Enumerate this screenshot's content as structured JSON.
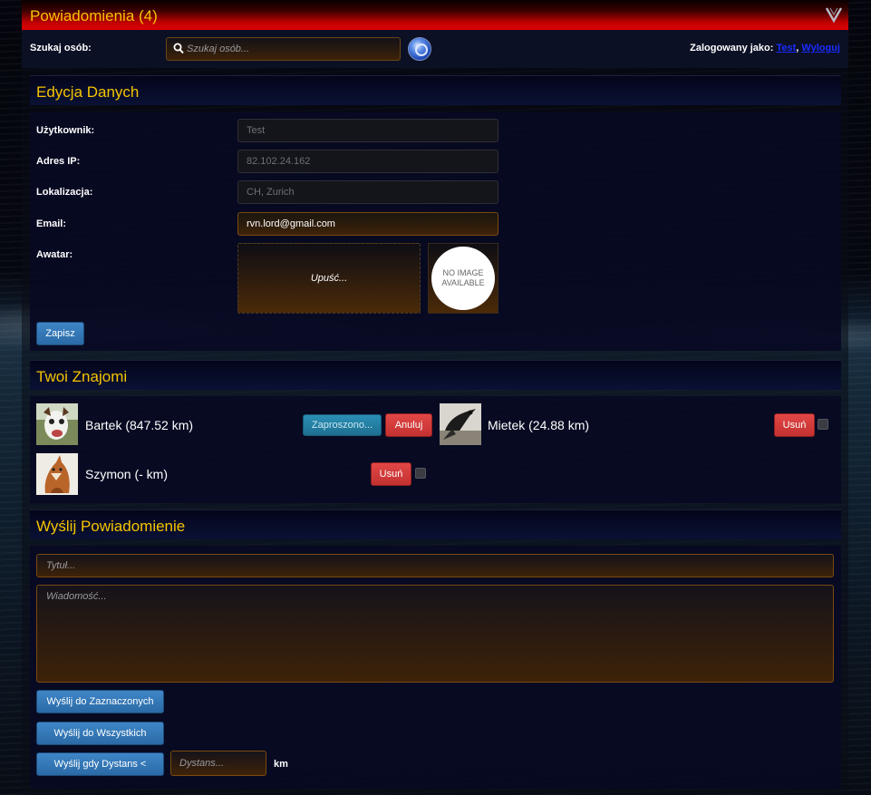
{
  "notifications": {
    "title": "Powiadomienia (4)",
    "toggle_icon": "chevron-down-icon"
  },
  "topbar": {
    "search_label": "Szukaj osób:",
    "search_placeholder": "Szukaj osób...",
    "logged_as_label": "Zalogowany jako:",
    "username_link": "Test",
    "separator": ",",
    "logout_link": "Wyloguj"
  },
  "profile": {
    "title": "Edycja Danych",
    "user_label": "Użytkownik:",
    "user_value": "Test",
    "ip_label": "Adres IP:",
    "ip_value": "82.102.24.162",
    "location_label": "Lokalizacja:",
    "location_value": "CH, Zurich",
    "email_label": "Email:",
    "email_value": "rvn.lord@gmail.com",
    "avatar_label": "Awatar:",
    "dropzone_text": "Upuść...",
    "no_image_line1": "NO IMAGE",
    "no_image_line2": "AVAILABLE",
    "save_button": "Zapisz"
  },
  "friends": {
    "title": "Twoi Znajomi",
    "items": [
      {
        "name": "Bartek (847.52 km)",
        "invited_button": "Zaproszono...",
        "cancel_button": "Anuluj"
      },
      {
        "name": "Mietek (24.88 km)",
        "remove_button": "Usuń"
      },
      {
        "name": "Szymon (- km)",
        "remove_button": "Usuń"
      }
    ]
  },
  "message": {
    "title": "Wyślij Powiadomienie",
    "title_placeholder": "Tytuł...",
    "body_placeholder": "Wiadomość...",
    "send_selected": "Wyślij do Zaznaczonych",
    "send_all": "Wyślij do Wszystkich",
    "send_distance": "Wyślij gdy Dystans <",
    "distance_placeholder": "Dystans...",
    "distance_unit": "km"
  },
  "colors": {
    "accent_yellow": "#f5c400",
    "notif_red": "#e00000",
    "link_blue": "#1a2cff"
  }
}
